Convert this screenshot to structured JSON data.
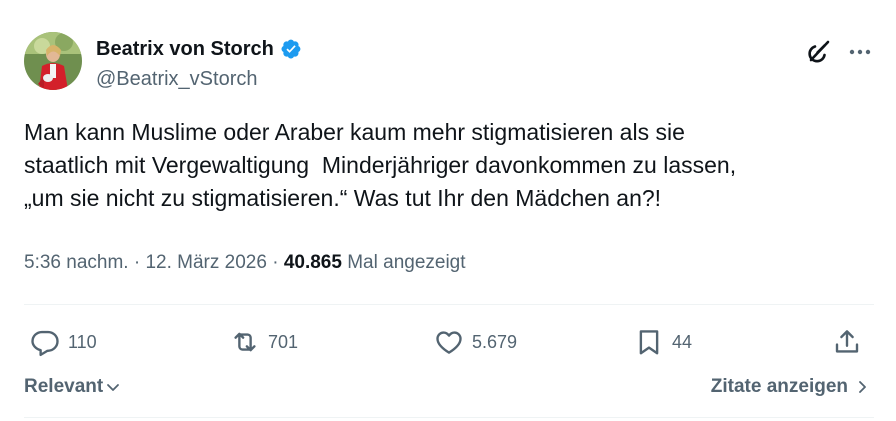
{
  "author": {
    "display_name": "Beatrix von Storch",
    "handle": "@Beatrix_vStorch",
    "verified": true
  },
  "tweet": {
    "text": "Man kann Muslime oder Araber kaum mehr stigmatisieren als sie\nstaatlich mit Vergewaltigung  Minderjähriger davonkommen zu lassen,\n„um sie nicht zu stigmatisieren.“ Was tut Ihr den Mädchen an?!"
  },
  "meta": {
    "time": "5:36 nachm.",
    "separator": "·",
    "date": "12. März 2026",
    "separator2": "·",
    "views": "40.865",
    "views_label": "Mal angezeigt"
  },
  "actions": {
    "replies": "110",
    "reposts": "701",
    "likes": "5.679",
    "bookmarks": "44"
  },
  "footer": {
    "sort_label": "Relevant",
    "quotes_label": "Zitate anzeigen"
  },
  "colors": {
    "text": "#0f1419",
    "secondary": "#536471",
    "verified": "#1d9bf0",
    "divider": "#eff3f4"
  },
  "icons": [
    "verified-badge-icon",
    "grok-icon",
    "more-icon",
    "reply-icon",
    "repost-icon",
    "like-icon",
    "bookmark-icon",
    "share-icon",
    "chevron-down-icon",
    "chevron-right-icon"
  ]
}
